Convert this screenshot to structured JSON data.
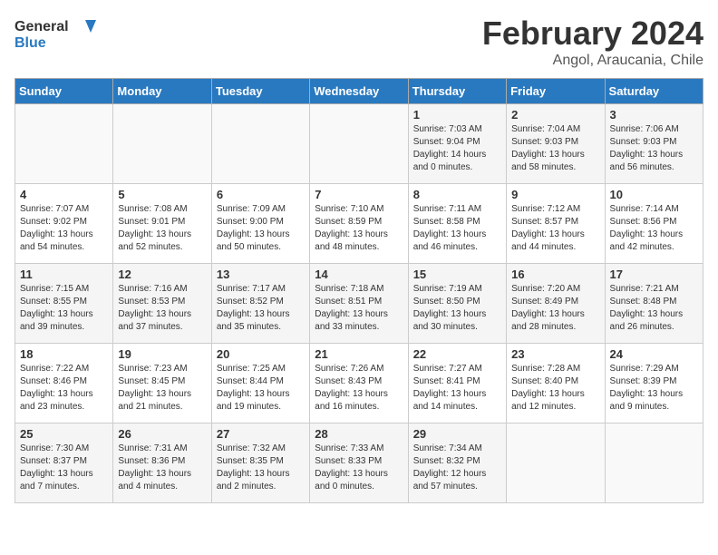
{
  "header": {
    "logo_line1": "General",
    "logo_line2": "Blue",
    "title": "February 2024",
    "subtitle": "Angol, Araucania, Chile"
  },
  "weekdays": [
    "Sunday",
    "Monday",
    "Tuesday",
    "Wednesday",
    "Thursday",
    "Friday",
    "Saturday"
  ],
  "weeks": [
    [
      {
        "day": "",
        "info": ""
      },
      {
        "day": "",
        "info": ""
      },
      {
        "day": "",
        "info": ""
      },
      {
        "day": "",
        "info": ""
      },
      {
        "day": "1",
        "info": "Sunrise: 7:03 AM\nSunset: 9:04 PM\nDaylight: 14 hours\nand 0 minutes."
      },
      {
        "day": "2",
        "info": "Sunrise: 7:04 AM\nSunset: 9:03 PM\nDaylight: 13 hours\nand 58 minutes."
      },
      {
        "day": "3",
        "info": "Sunrise: 7:06 AM\nSunset: 9:03 PM\nDaylight: 13 hours\nand 56 minutes."
      }
    ],
    [
      {
        "day": "4",
        "info": "Sunrise: 7:07 AM\nSunset: 9:02 PM\nDaylight: 13 hours\nand 54 minutes."
      },
      {
        "day": "5",
        "info": "Sunrise: 7:08 AM\nSunset: 9:01 PM\nDaylight: 13 hours\nand 52 minutes."
      },
      {
        "day": "6",
        "info": "Sunrise: 7:09 AM\nSunset: 9:00 PM\nDaylight: 13 hours\nand 50 minutes."
      },
      {
        "day": "7",
        "info": "Sunrise: 7:10 AM\nSunset: 8:59 PM\nDaylight: 13 hours\nand 48 minutes."
      },
      {
        "day": "8",
        "info": "Sunrise: 7:11 AM\nSunset: 8:58 PM\nDaylight: 13 hours\nand 46 minutes."
      },
      {
        "day": "9",
        "info": "Sunrise: 7:12 AM\nSunset: 8:57 PM\nDaylight: 13 hours\nand 44 minutes."
      },
      {
        "day": "10",
        "info": "Sunrise: 7:14 AM\nSunset: 8:56 PM\nDaylight: 13 hours\nand 42 minutes."
      }
    ],
    [
      {
        "day": "11",
        "info": "Sunrise: 7:15 AM\nSunset: 8:55 PM\nDaylight: 13 hours\nand 39 minutes."
      },
      {
        "day": "12",
        "info": "Sunrise: 7:16 AM\nSunset: 8:53 PM\nDaylight: 13 hours\nand 37 minutes."
      },
      {
        "day": "13",
        "info": "Sunrise: 7:17 AM\nSunset: 8:52 PM\nDaylight: 13 hours\nand 35 minutes."
      },
      {
        "day": "14",
        "info": "Sunrise: 7:18 AM\nSunset: 8:51 PM\nDaylight: 13 hours\nand 33 minutes."
      },
      {
        "day": "15",
        "info": "Sunrise: 7:19 AM\nSunset: 8:50 PM\nDaylight: 13 hours\nand 30 minutes."
      },
      {
        "day": "16",
        "info": "Sunrise: 7:20 AM\nSunset: 8:49 PM\nDaylight: 13 hours\nand 28 minutes."
      },
      {
        "day": "17",
        "info": "Sunrise: 7:21 AM\nSunset: 8:48 PM\nDaylight: 13 hours\nand 26 minutes."
      }
    ],
    [
      {
        "day": "18",
        "info": "Sunrise: 7:22 AM\nSunset: 8:46 PM\nDaylight: 13 hours\nand 23 minutes."
      },
      {
        "day": "19",
        "info": "Sunrise: 7:23 AM\nSunset: 8:45 PM\nDaylight: 13 hours\nand 21 minutes."
      },
      {
        "day": "20",
        "info": "Sunrise: 7:25 AM\nSunset: 8:44 PM\nDaylight: 13 hours\nand 19 minutes."
      },
      {
        "day": "21",
        "info": "Sunrise: 7:26 AM\nSunset: 8:43 PM\nDaylight: 13 hours\nand 16 minutes."
      },
      {
        "day": "22",
        "info": "Sunrise: 7:27 AM\nSunset: 8:41 PM\nDaylight: 13 hours\nand 14 minutes."
      },
      {
        "day": "23",
        "info": "Sunrise: 7:28 AM\nSunset: 8:40 PM\nDaylight: 13 hours\nand 12 minutes."
      },
      {
        "day": "24",
        "info": "Sunrise: 7:29 AM\nSunset: 8:39 PM\nDaylight: 13 hours\nand 9 minutes."
      }
    ],
    [
      {
        "day": "25",
        "info": "Sunrise: 7:30 AM\nSunset: 8:37 PM\nDaylight: 13 hours\nand 7 minutes."
      },
      {
        "day": "26",
        "info": "Sunrise: 7:31 AM\nSunset: 8:36 PM\nDaylight: 13 hours\nand 4 minutes."
      },
      {
        "day": "27",
        "info": "Sunrise: 7:32 AM\nSunset: 8:35 PM\nDaylight: 13 hours\nand 2 minutes."
      },
      {
        "day": "28",
        "info": "Sunrise: 7:33 AM\nSunset: 8:33 PM\nDaylight: 13 hours\nand 0 minutes."
      },
      {
        "day": "29",
        "info": "Sunrise: 7:34 AM\nSunset: 8:32 PM\nDaylight: 12 hours\nand 57 minutes."
      },
      {
        "day": "",
        "info": ""
      },
      {
        "day": "",
        "info": ""
      }
    ]
  ]
}
